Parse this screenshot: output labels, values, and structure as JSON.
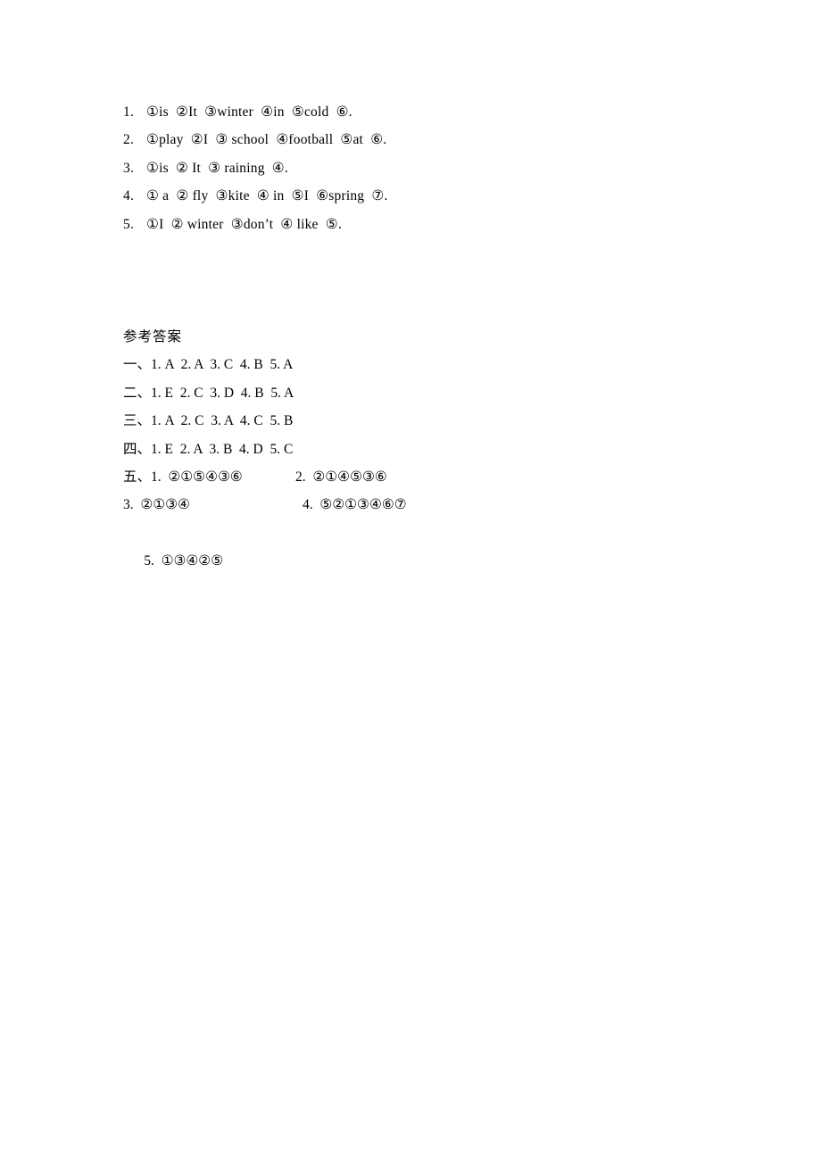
{
  "document": {
    "exercise": {
      "name": "sentence-ordering-exercise",
      "items": [
        {
          "number": "1.",
          "content": "①is  ②It  ③winter  ④in  ⑤cold  ⑥."
        },
        {
          "number": "2.",
          "content": "①play  ②I  ③ school  ④football  ⑤at  ⑥."
        },
        {
          "number": "3.",
          "content": "①is  ② It  ③ raining  ④."
        },
        {
          "number": "4.",
          "content": "① a  ② fly  ③kite  ④ in  ⑤I  ⑥spring  ⑦."
        },
        {
          "number": "5.",
          "content": "①I  ② winter  ③don’t  ④ like  ⑤."
        }
      ]
    },
    "answer_key": {
      "heading": "参考答案",
      "sections": [
        {
          "marker": "一、",
          "answers": "1. A  2. A  3. C  4. B  5. A"
        },
        {
          "marker": "二、",
          "answers": "1. E  2. C  3. D  4. B  5. A"
        },
        {
          "marker": "三、",
          "answers": "1. A  2. C  3. A  4. C  5. B"
        },
        {
          "marker": "四、",
          "answers": "1. E  2. A  3. B  4. D  5. C"
        }
      ],
      "section_five": {
        "marker": "五、",
        "row1_left": "1.  ②①⑤④③⑥",
        "row1_right": "2.  ②①④⑤③⑥",
        "row2_left": "3.  ②①③④",
        "row2_right": "4.  ⑤②①③④⑥⑦",
        "row3_left": "5.  ①③④②⑤"
      }
    }
  }
}
